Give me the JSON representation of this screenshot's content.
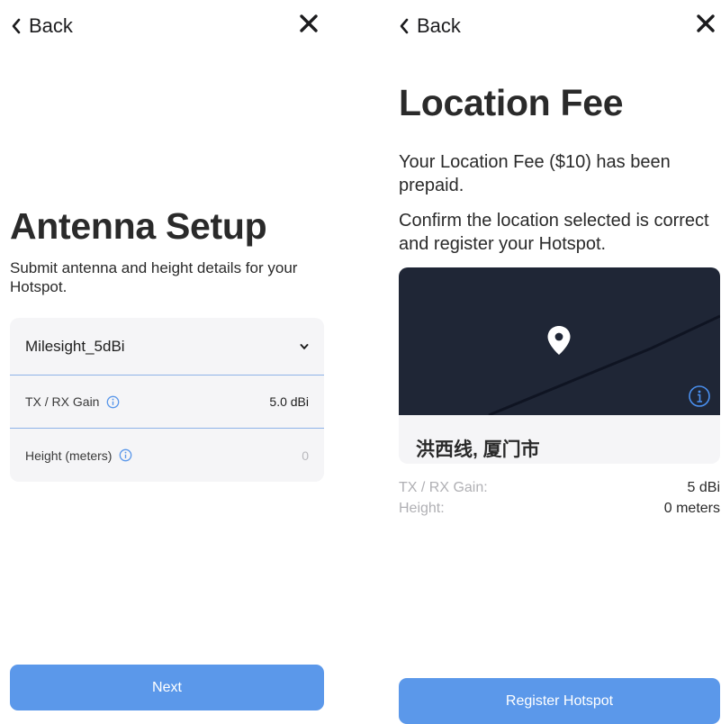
{
  "left": {
    "back_label": "Back",
    "title": "Antenna Setup",
    "subtitle": "Submit antenna and height details for your Hotspot.",
    "antenna_select": "Milesight_5dBi",
    "gain_label": "TX / RX Gain",
    "gain_value": "5.0 dBi",
    "height_label": "Height (meters)",
    "height_placeholder": "0",
    "next_label": "Next"
  },
  "right": {
    "back_label": "Back",
    "title": "Location Fee",
    "fee_text": "Your Location Fee ($10) has been prepaid.",
    "confirm_text": "Confirm the location selected is correct and register your Hotspot.",
    "location_name": "洪西线, 厦门市",
    "summary": {
      "gain_key": "TX / RX Gain:",
      "gain_val": "5 dBi",
      "height_key": "Height:",
      "height_val": "0 meters"
    },
    "register_label": "Register Hotspot"
  },
  "icons": {
    "back": "chevron-left-icon",
    "close": "close-icon",
    "info": "info-icon",
    "dropdown": "chevron-down-icon",
    "map_pin": "map-pin-icon"
  },
  "colors": {
    "accent": "#5b98ea",
    "map_bg": "#1f2636",
    "card_bg": "#f5f5f7",
    "divider": "#8fb3e8"
  }
}
